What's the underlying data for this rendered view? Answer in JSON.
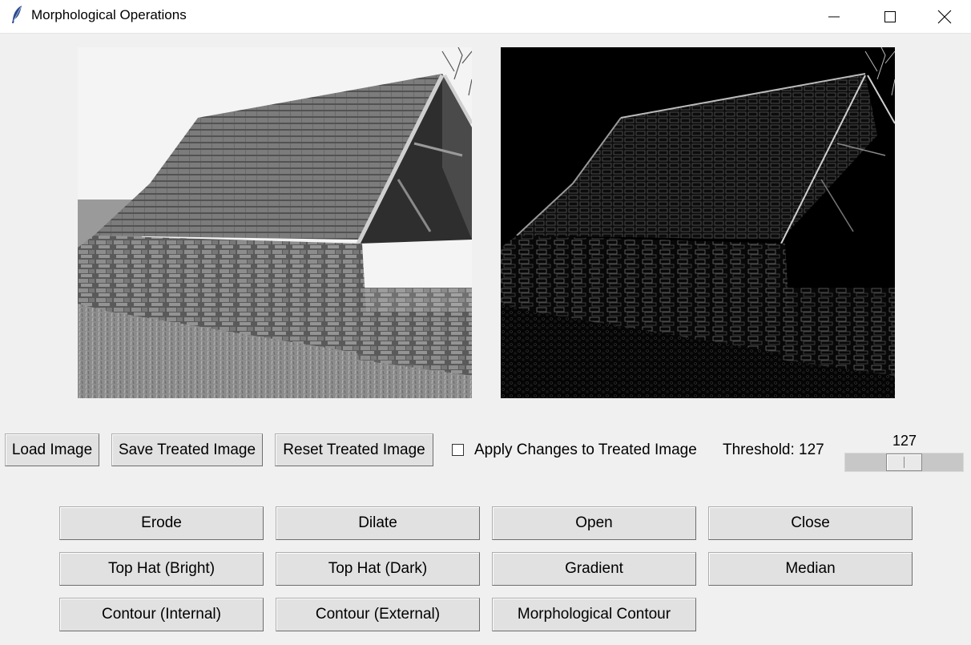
{
  "window": {
    "title": "Morphological Operations"
  },
  "toolbar": {
    "load_label": "Load Image",
    "save_label": "Save Treated Image",
    "reset_label": "Reset Treated Image",
    "apply_changes_label": "Apply Changes to Treated Image",
    "apply_changes_checked": false,
    "threshold_label": "Threshold: 127",
    "slider_value": "127",
    "slider_fraction": 0.5
  },
  "operations": {
    "erode": "Erode",
    "dilate": "Dilate",
    "open": "Open",
    "close": "Close",
    "top_hat_bright": "Top Hat (Bright)",
    "top_hat_dark": "Top Hat (Dark)",
    "gradient": "Gradient",
    "median": "Median",
    "contour_internal": "Contour (Internal)",
    "contour_external": "Contour (External)",
    "morphological_contour": "Morphological Contour"
  },
  "images": {
    "original": "original-image",
    "treated": "treated-image"
  }
}
